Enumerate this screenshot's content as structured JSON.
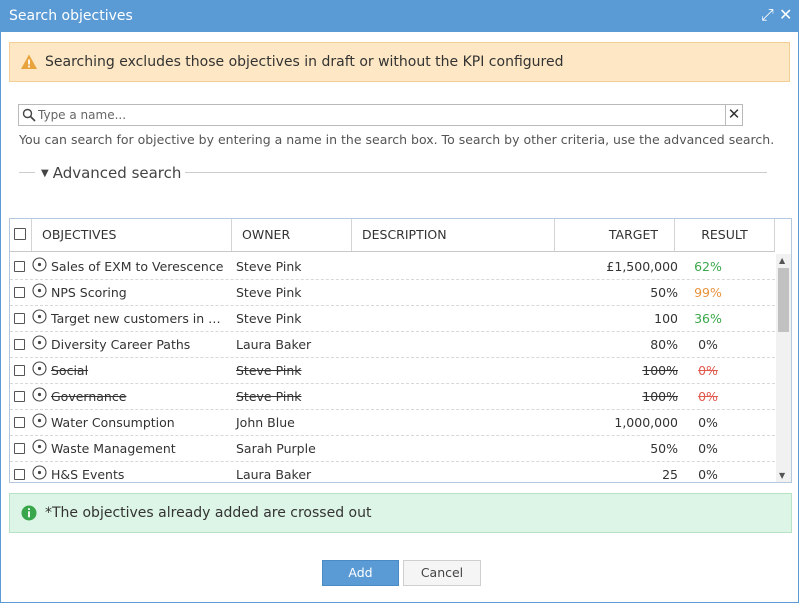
{
  "dialog": {
    "title": "Search objectives",
    "maximize_glyph": "⤢",
    "close_glyph": "✕"
  },
  "warning": {
    "text": "Searching excludes those objectives in draft or without the KPI configured",
    "icon": "warning-icon",
    "color": "#e8a33c"
  },
  "search": {
    "placeholder": "Type a name...",
    "value": "",
    "clear_glyph": "✕",
    "hint": "You can search for objective by entering a name in the search box. To search by other criteria, use the advanced search."
  },
  "advanced": {
    "label": "Advanced search"
  },
  "table": {
    "columns": {
      "objectives": "OBJECTIVES",
      "owner": "OWNER",
      "description": "DESCRIPTION",
      "target": "TARGET",
      "result": "RESULT"
    },
    "rows": [
      {
        "name": "Sales of EXM to Verescence",
        "owner": "Steve Pink",
        "target": "£1,500,000",
        "result": "62%",
        "result_color": "#3aa64b",
        "crossed": false
      },
      {
        "name": "NPS Scoring",
        "owner": "Steve Pink",
        "target": "50%",
        "result": "99%",
        "result_color": "#e8923a",
        "crossed": false
      },
      {
        "name": "Target new customers in U...",
        "owner": "Steve Pink",
        "target": "100",
        "result": "36%",
        "result_color": "#3aa64b",
        "crossed": false
      },
      {
        "name": "Diversity Career Paths",
        "owner": "Laura Baker",
        "target": "80%",
        "result": "0%",
        "result_color": "#333333",
        "crossed": false
      },
      {
        "name": "Social",
        "owner": "Steve Pink",
        "target": "100%",
        "result": "0%",
        "result_color": "#e05a4e",
        "crossed": true
      },
      {
        "name": "Governance",
        "owner": "Steve Pink",
        "target": "100%",
        "result": "0%",
        "result_color": "#e05a4e",
        "crossed": true
      },
      {
        "name": "Water Consumption",
        "owner": "John Blue",
        "target": "1,000,000",
        "result": "0%",
        "result_color": "#333333",
        "crossed": false
      },
      {
        "name": "Waste Management",
        "owner": "Sarah Purple",
        "target": "50%",
        "result": "0%",
        "result_color": "#333333",
        "crossed": false
      },
      {
        "name": "H&S Events",
        "owner": "Laura Baker",
        "target": "25",
        "result": "0%",
        "result_color": "#333333",
        "crossed": false
      }
    ]
  },
  "info": {
    "text": "*The objectives already added are crossed out",
    "icon": "info-icon",
    "color": "#3aa64b"
  },
  "buttons": {
    "add": "Add",
    "cancel": "Cancel"
  },
  "colors": {
    "accent": "#5b9bd5",
    "warning_bg": "#fde7c4",
    "info_bg": "#ddf5e6"
  }
}
